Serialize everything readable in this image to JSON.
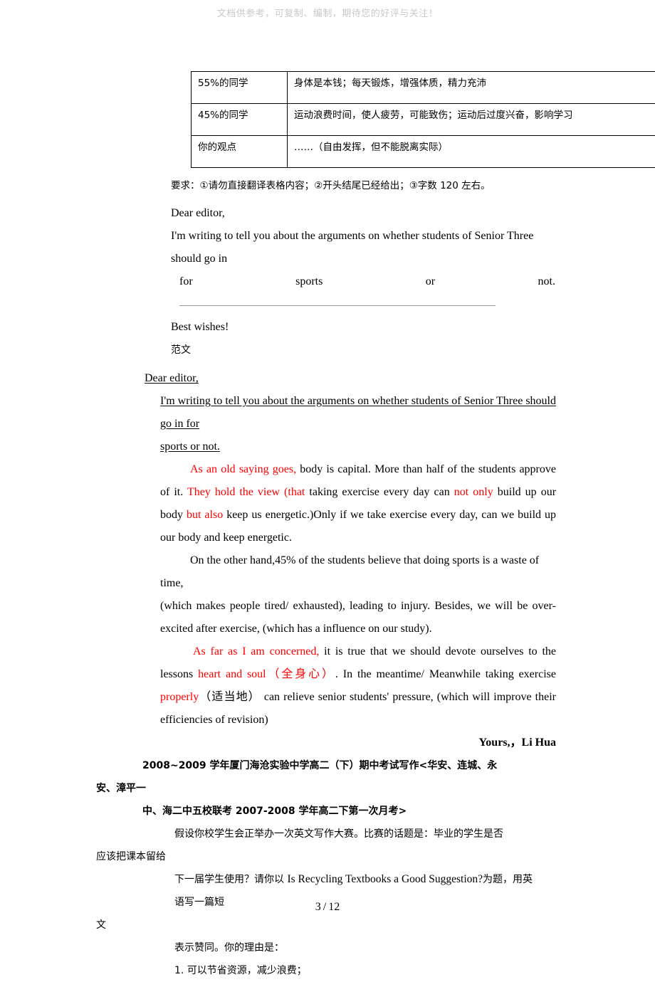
{
  "header": {
    "watermark": "文档供参考，可复制、编制，期待您的好评与关注！"
  },
  "table": {
    "rows": [
      {
        "label": "55%的同学",
        "content": "身体是本钱；每天锻炼，增强体质，精力充沛"
      },
      {
        "label": "45%的同学",
        "content": "运动浪费时间，使人疲劳，可能致伤；运动后过度兴奋，影响学习"
      },
      {
        "label": "你的观点",
        "content": "……（自由发挥，但不能脱离实际）"
      }
    ]
  },
  "requirements": {
    "line": "要求：①请勿直接翻译表格内容；②开头结尾已经给出；③字数 120 左右。"
  },
  "prompt_letter": {
    "salutation": "Dear editor,",
    "opening": "I'm writing to tell you about the arguments on whether students of Senior Three should go in",
    "justified_words": [
      "for",
      "sports",
      "or",
      "not."
    ],
    "closing": "Best wishes!",
    "model_label": "范文"
  },
  "model_essay": {
    "salutation": "Dear editor,",
    "opening_line1": "I'm writing to tell you about the arguments on whether students of Senior Three should go in for",
    "opening_line2": "sports or not.",
    "para1": [
      {
        "text": "As an old saying goes,",
        "color": "red"
      },
      {
        "text": " body is capital. More than half of the students approve of it. ",
        "color": "black"
      },
      {
        "text": "They hold the view (that",
        "color": "red"
      },
      {
        "text": " taking exercise every day can ",
        "color": "black"
      },
      {
        "text": "not only",
        "color": "red"
      },
      {
        "text": " build up our body ",
        "color": "black"
      },
      {
        "text": "but also",
        "color": "red"
      },
      {
        "text": " keep us energetic.)Only if we take exercise every day, can we build up our body and keep energetic.",
        "color": "black"
      }
    ],
    "para2_line1": "On the other hand,45% of the students believe that doing sports is a waste of time,",
    "para2_rest": "(which makes people tired/ exhausted), leading to injury. Besides, we will be over-excited after exercise, (which has a influence on our study).",
    "para3": [
      {
        "text": "As far as I am concerned,",
        "color": "red"
      },
      {
        "text": " it is true that we should devote ourselves to the lessons ",
        "color": "black"
      },
      {
        "text": "heart and soul（全身心）",
        "color": "red"
      },
      {
        "text": ". In the meantime/ Meanwhile taking exercise ",
        "color": "black"
      },
      {
        "text": "properly",
        "color": "red"
      },
      {
        "text": "（适当地）   can relieve senior students' pressure, (which will improve their efficiencies of revision)",
        "color": "black"
      }
    ],
    "signature": "Yours,，Li Hua"
  },
  "next_section": {
    "heading_line1": "2008~2009 学年厦门海沧实验中学高二（下）期中考试写作<华安、连城、永",
    "heading_line2": "安、漳平一",
    "heading_line3": "中、海二中五校联考 2007-2008 学年高二下第一次月考>",
    "body_line1": "假设你校学生会正举办一次英文写作大赛。比赛的话题是：毕业的学生是否",
    "body_line2": "应该把课本留给",
    "body_line3_pre": "下一届学生使用？请你以 ",
    "body_line3_title": "Is Recycling Textbooks a Good Suggestion?",
    "body_line3_post": "为题，用英语写一篇短",
    "body_line4": "文",
    "body_line5": "表示赞同。你的理由是：",
    "reason_1": "1. 可以节省资源，减少浪费；"
  },
  "footer": {
    "current_page": "3",
    "separator": "/",
    "total_pages": "12"
  }
}
